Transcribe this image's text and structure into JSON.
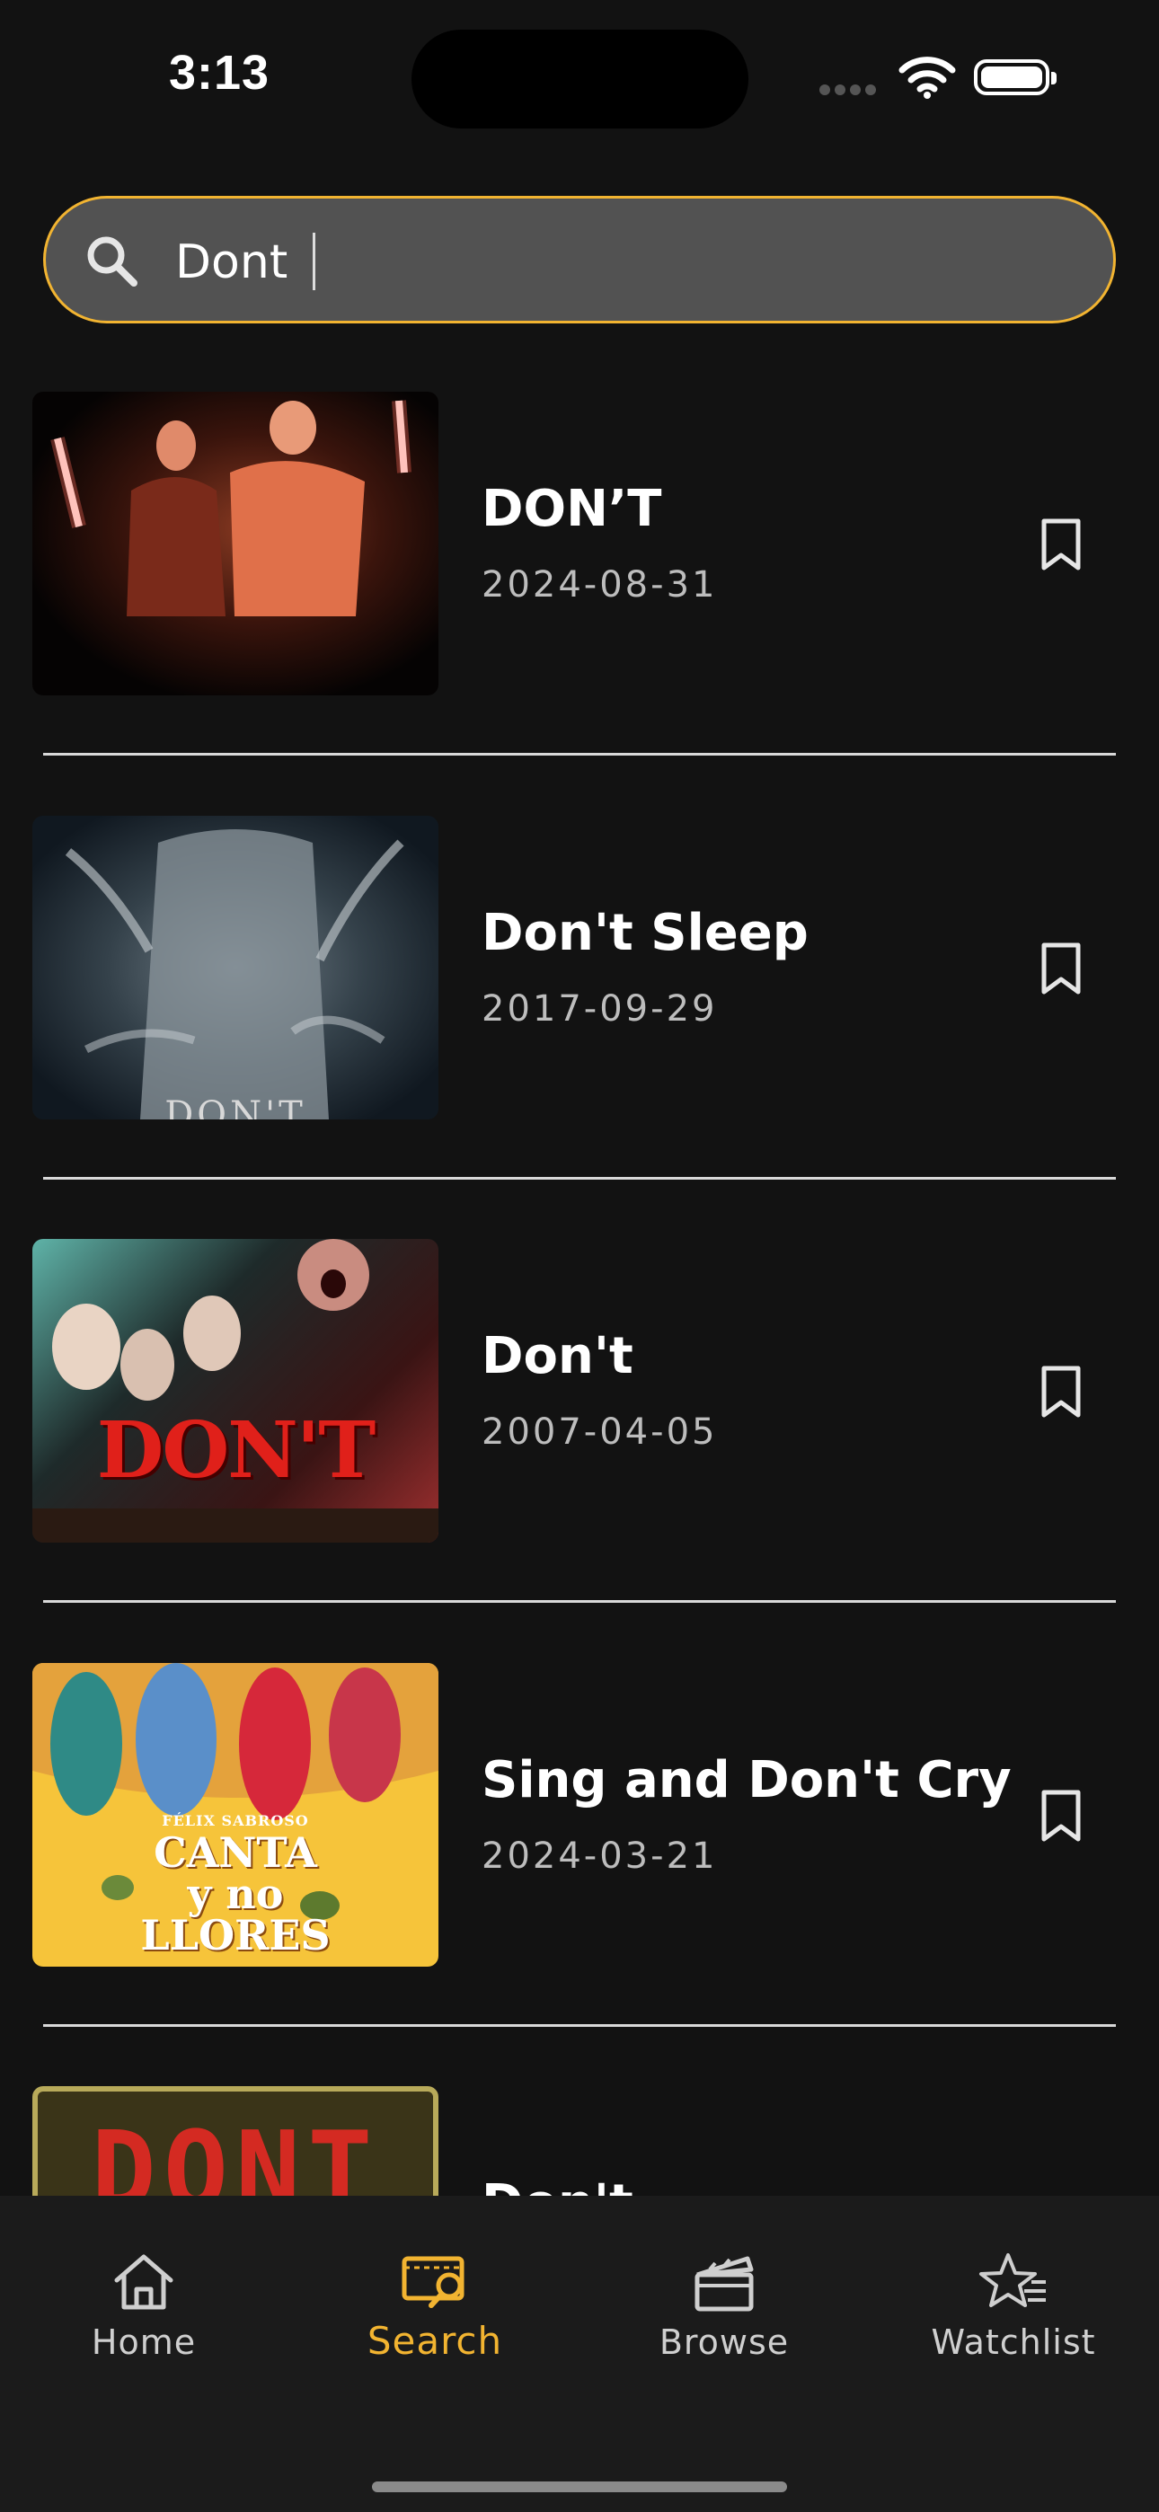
{
  "status": {
    "time": "3:13"
  },
  "search": {
    "value": "Dont",
    "placeholder": ""
  },
  "results": [
    {
      "title": "DON’T",
      "date": "2024-08-31",
      "poster": "two people holding light sticks",
      "poster_text": ""
    },
    {
      "title": "Don't Sleep",
      "date": "2017-09-29",
      "poster": "figure grabbed by hands",
      "poster_text": "DON'T"
    },
    {
      "title": "Don't",
      "date": "2007-04-05",
      "poster": "screaming faces",
      "poster_text": "DON'T"
    },
    {
      "title": "Sing and Don't Cry",
      "date": "2024-03-21",
      "poster": "colorful comedy poster",
      "poster_text": "CANTA y no LLORES",
      "poster_small_text": "FÉLIX SABROSO"
    },
    {
      "title": "Don't",
      "date": "",
      "poster": "red neon sign",
      "poster_text": "DONT"
    }
  ],
  "tabs": [
    {
      "label": "Home",
      "icon": "home-icon"
    },
    {
      "label": "Search",
      "icon": "search-ticket-icon",
      "active": true
    },
    {
      "label": "Browse",
      "icon": "clapperboard-icon"
    },
    {
      "label": "Watchlist",
      "icon": "star-list-icon"
    }
  ],
  "colors": {
    "accent": "#f2b431",
    "background": "#121212",
    "search_bg": "#525252"
  }
}
